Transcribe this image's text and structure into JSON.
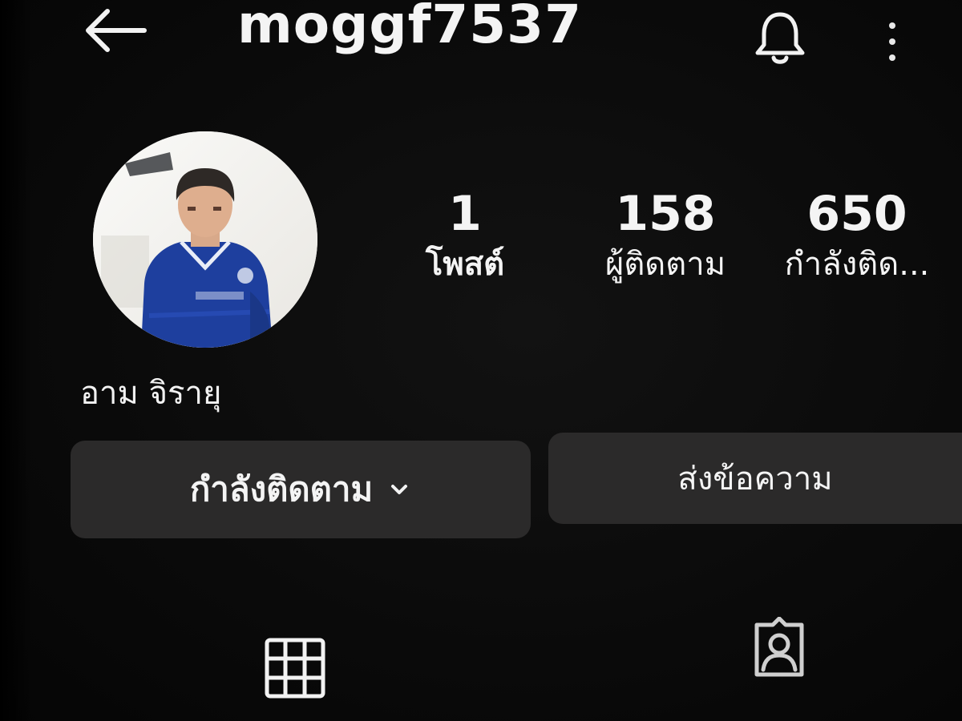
{
  "header": {
    "username": "moggf7537",
    "back_icon": "arrow-left-icon",
    "notifications_icon": "bell-icon",
    "more_icon": "vertical-dots-icon"
  },
  "profile": {
    "avatar_alt": "profile photo",
    "display_name": "อาม จิรายุ",
    "stats": {
      "posts": {
        "value": "1",
        "label": "โพสต์"
      },
      "followers": {
        "value": "158",
        "label": "ผู้ติดตาม"
      },
      "following": {
        "value": "650",
        "label": "กำลังติด..."
      }
    }
  },
  "actions": {
    "following_label": "กำลังติดตาม",
    "message_label": "ส่งข้อความ"
  },
  "tabs": {
    "grid_icon": "grid-icon",
    "tagged_icon": "tagged-person-icon"
  },
  "colors": {
    "background": "#0b0b0b",
    "button": "#2b2a2a",
    "text": "#f4f4f4",
    "jersey": "#1e3f9e"
  }
}
